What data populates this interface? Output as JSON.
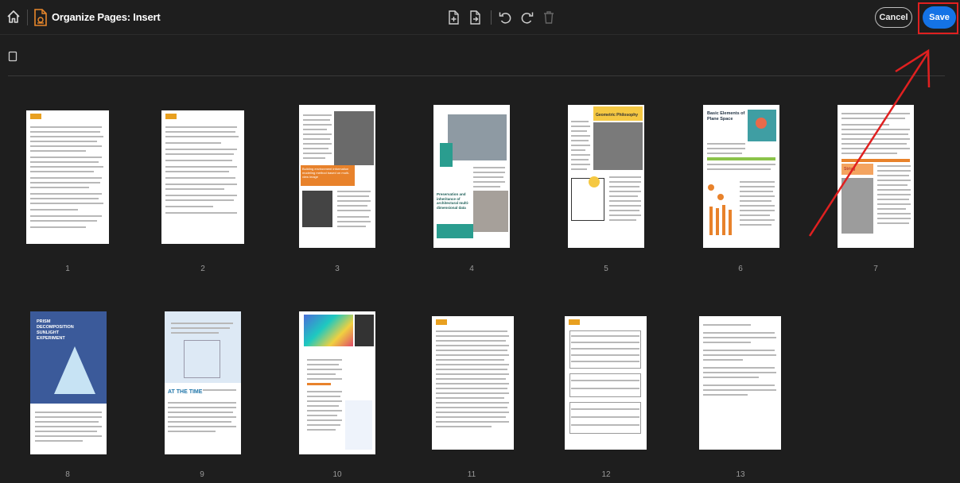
{
  "toolbar": {
    "title": "Organize Pages: Insert",
    "cancel_label": "Cancel",
    "save_label": "Save",
    "icons": [
      "home-icon",
      "document-icon",
      "insert-page-icon",
      "extract-page-icon",
      "rotate-left-icon",
      "rotate-right-icon",
      "delete-icon"
    ]
  },
  "colors": {
    "accent": "#1473e6",
    "highlight": "#e02020",
    "background": "#1e1e1e"
  },
  "pages": [
    {
      "number": "1"
    },
    {
      "number": "2"
    },
    {
      "number": "3"
    },
    {
      "number": "4"
    },
    {
      "number": "5"
    },
    {
      "number": "6"
    },
    {
      "number": "7"
    },
    {
      "number": "8"
    },
    {
      "number": "9"
    },
    {
      "number": "10"
    },
    {
      "number": "11"
    },
    {
      "number": "12"
    },
    {
      "number": "13"
    }
  ],
  "page_text": {
    "p3_heading": "Building environment information modeling method based on multi-view image",
    "p4_heading": "Preservation and inheritance of architectural multi-dimensional data",
    "p5_heading": "Geometric Philosophy",
    "p6_heading": "Basic Elements of Plane Space",
    "p7_heading": "String",
    "p8_title": "PRISM DECOMPOSITION SUNLIGHT EXPERIMENT",
    "p9_heading": "AT THE TIME"
  }
}
